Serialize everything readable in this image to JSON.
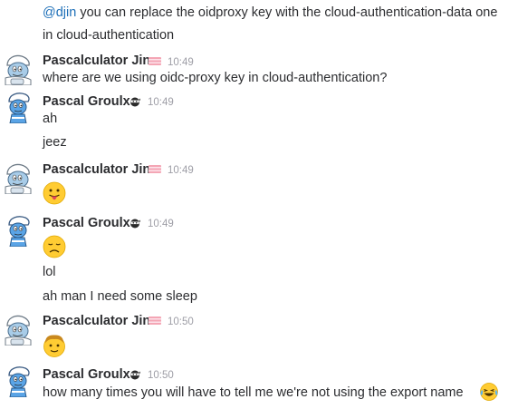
{
  "messages": {
    "m0": {
      "mention": "@djin",
      "text": " you can replace the oidproxy key with the cloud-authentication-data one",
      "text2": "in cloud-authentication"
    },
    "g1": {
      "author": "Pascalculator Jin",
      "time": "10:49",
      "lines": [
        "where are we using oidc-proxy key in cloud-authentication?"
      ]
    },
    "g2": {
      "author": "Pascal Groulx",
      "time": "10:49",
      "lines": [
        "ah",
        "jeez"
      ]
    },
    "g3": {
      "author": "Pascalculator Jin",
      "time": "10:49",
      "emoji": "tongue-out-face"
    },
    "g4": {
      "author": "Pascal Groulx",
      "time": "10:49",
      "emoji": "disappointed-face",
      "lines": [
        "lol",
        "ah man I need some sleep"
      ]
    },
    "g5": {
      "author": "Pascalculator Jin",
      "time": "10:50",
      "emoji": "older-face"
    },
    "g6": {
      "author": "Pascal Groulx",
      "time": "10:50",
      "lines": [
        "how many times you will have to tell me we're not using the export name"
      ],
      "emoji": "laughing-tears-face"
    }
  },
  "colors": {
    "mention": "#1d6fb8",
    "timestamp": "#9e9ea6",
    "text": "#2c2d30",
    "flag": "#f4a6b5"
  }
}
